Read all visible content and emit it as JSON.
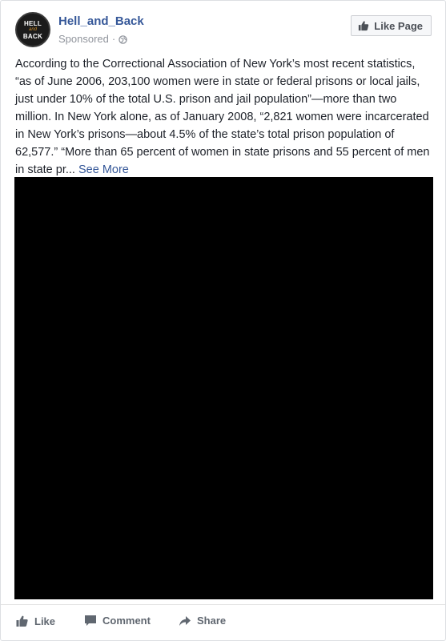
{
  "post": {
    "page_name": "Hell_and_Back",
    "sponsored_label": "Sponsored",
    "meta_separator": "·",
    "avatar": {
      "top_text": "HELL",
      "mid_text": "and",
      "bottom_text": "BACK"
    },
    "like_page_label": "Like Page",
    "text": "According to the Correctional Association of New York’s most recent statistics, “as of June 2006, 203,100 women were in state or federal prisons or local jails, just under 10% of the total U.S. prison and jail population”—more than two million. In New York alone, as of January 2008, “2,821 women were incarcerated in New York’s prisons—about 4.5% of the state’s total prison population of 62,577.” “More than 65 percent of women in state prisons and 55 percent of men in state pr...",
    "see_more_label": "See More"
  },
  "actions": {
    "like_label": "Like",
    "comment_label": "Comment",
    "share_label": "Share"
  },
  "icons": {
    "globe": "globe-icon",
    "thumb": "thumbs-up-icon",
    "comment": "comment-icon",
    "share": "share-icon"
  },
  "colors": {
    "link_blue": "#365899",
    "meta_gray": "#90949c",
    "action_gray": "#606770",
    "media_bg": "#000000"
  }
}
